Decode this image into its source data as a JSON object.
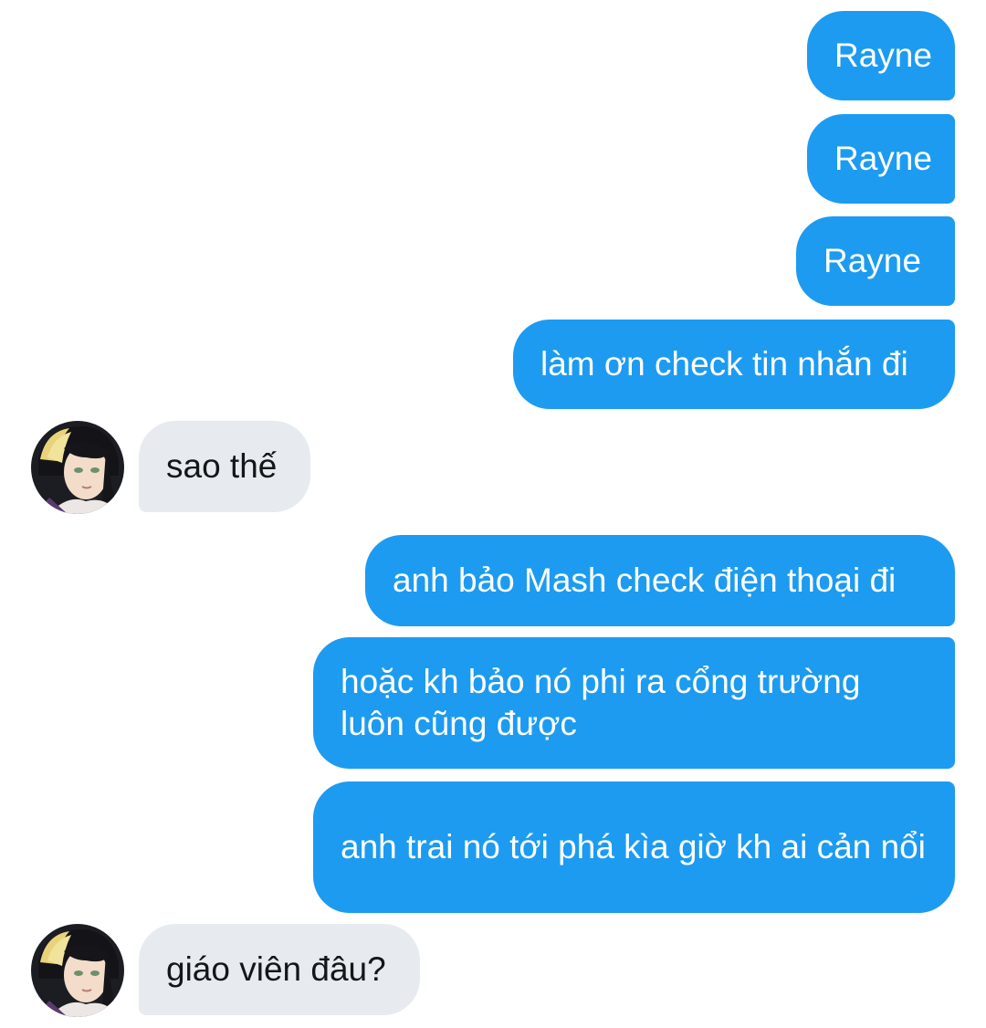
{
  "conversation": {
    "messages": [
      {
        "side": "sent",
        "text": "Rayne"
      },
      {
        "side": "sent",
        "text": "Rayne"
      },
      {
        "side": "sent",
        "text": "Rayne"
      },
      {
        "side": "sent",
        "text": "làm ơn check tin nhắn đi"
      },
      {
        "side": "received",
        "text": "sao thế"
      },
      {
        "side": "sent",
        "text": "anh bảo Mash check điện thoại đi"
      },
      {
        "side": "sent",
        "text": "hoặc kh bảo nó phi ra cổng trường luôn cũng được"
      },
      {
        "side": "sent",
        "text": "anh trai nó tới phá kìa giờ kh ai cản nổi"
      },
      {
        "side": "received",
        "text": "giáo viên đâu?"
      }
    ]
  },
  "colors": {
    "sent_bubble": "#1d9bf0",
    "received_bubble": "#e7ebef",
    "background": "#ffffff"
  },
  "icons": {
    "contact_avatar": "avatar-portrait-icon"
  }
}
